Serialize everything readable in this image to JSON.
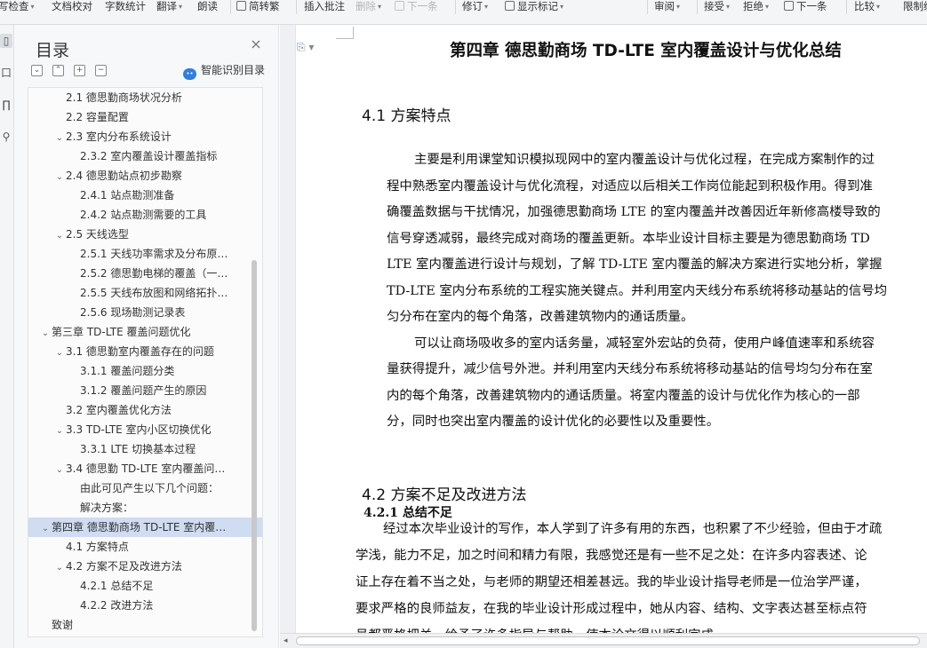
{
  "toolbar": {
    "items": [
      {
        "label": "写检查",
        "caret": true
      },
      {
        "label": "文档校对"
      },
      {
        "label": "字数统计"
      },
      {
        "label": "翻译",
        "caret": true
      },
      {
        "label": "朗读"
      },
      {
        "label": "简转繁",
        "icon": "convert-icon"
      },
      {
        "label": "插入批注"
      },
      {
        "label": "删除",
        "caret": true,
        "disabled": true
      },
      {
        "label": "下一条",
        "icon": "next-comment-icon",
        "disabled": true
      },
      {
        "label": "修订",
        "caret": true
      },
      {
        "label": "显示标记",
        "caret": true,
        "icon": "markup-icon"
      },
      {
        "label": "审阅",
        "caret": true
      },
      {
        "label": "接受",
        "caret": true
      },
      {
        "label": "拒绝",
        "caret": true
      },
      {
        "label": "下一条",
        "icon": "next-revision-icon"
      },
      {
        "label": "比较",
        "caret": true
      },
      {
        "label": "限制编"
      }
    ]
  },
  "sidebar_strip": {
    "icons": [
      "toc-icon",
      "bookmark-icon",
      "clipboard-icon",
      "search-icon"
    ],
    "glyphs": [
      "▯",
      "口",
      "∏",
      "⚲"
    ]
  },
  "toc": {
    "title": "目录",
    "close_glyph": "×",
    "controls": [
      "⌄",
      "⌃",
      "+",
      "−"
    ],
    "smart_label": "智能识别目录",
    "smart_icon_glyph": "••",
    "items": [
      {
        "level": 2,
        "text": "2.1 德思勤商场状况分析"
      },
      {
        "level": 2,
        "text": "2.2 容量配置"
      },
      {
        "level": 2,
        "text": "2.3 室内分布系统设计",
        "expanded": true
      },
      {
        "level": 3,
        "text": "2.3.2 室内覆盖设计覆盖指标"
      },
      {
        "level": 2,
        "text": "2.4 德思勤站点初步勘察",
        "expanded": true
      },
      {
        "level": 3,
        "text": "2.4.1 站点勘测准备"
      },
      {
        "level": 3,
        "text": "2.4.2 站点勘测需要的工具"
      },
      {
        "level": 2,
        "text": "2.5 天线选型",
        "expanded": true
      },
      {
        "level": 3,
        "text": "2.5.1 天线功率需求及分布原…"
      },
      {
        "level": 3,
        "text": "2.5.2 德思勤电梯的覆盖（一…"
      },
      {
        "level": 3,
        "text": "2.5.5 天线布放图和网络拓扑…"
      },
      {
        "level": 3,
        "text": "2.5.6 现场勘测记录表"
      },
      {
        "level": 1,
        "text": "第三章 TD-LTE 覆盖问题优化",
        "expanded": true
      },
      {
        "level": 2,
        "text": "3.1 德思勤室内覆盖存在的问题",
        "expanded": true
      },
      {
        "level": 3,
        "text": "3.1.1 覆盖问题分类"
      },
      {
        "level": 3,
        "text": "3.1.2 覆盖问题产生的原因"
      },
      {
        "level": 2,
        "text": "3.2 室内覆盖优化方法"
      },
      {
        "level": 2,
        "text": "3.3 TD-LTE 室内小区切换优化",
        "expanded": true
      },
      {
        "level": 3,
        "text": "3.3.1 LTE 切换基本过程"
      },
      {
        "level": 2,
        "text": "3.4 德思勤 TD-LTE 室内覆盖问…",
        "expanded": true
      },
      {
        "level": 3,
        "text": "由此可见产生以下几个问题："
      },
      {
        "level": 3,
        "text": "解决方案："
      },
      {
        "level": 1,
        "text": "第四章 德思勤商场 TD-LTE 室内覆…",
        "expanded": true,
        "selected": true
      },
      {
        "level": 2,
        "text": "4.1 方案特点"
      },
      {
        "level": 2,
        "text": "4.2 方案不足及改进方法",
        "expanded": true
      },
      {
        "level": 3,
        "text": "4.2.1 总结不足"
      },
      {
        "level": 3,
        "text": "4.2.2 改进方法"
      },
      {
        "level": 1,
        "text": "致谢"
      }
    ]
  },
  "document": {
    "page_mark": "⎘ ▾",
    "chapter_title": "第四章 德思勤商场 TD-LTE 室内覆盖设计与优化总结",
    "section_4_1": "4.1 方案特点",
    "lines_4_1": [
      "主要是利用课堂知识模拟现网中的室内覆盖设计与优化过程，在完成方案制作的过",
      "程中熟悉室内覆盖设计与优化流程，对适应以后相关工作岗位能起到积极作用。得到准",
      "确覆盖数据与干扰情况，加强德思勤商场 LTE 的室内覆盖并改善因近年新修高楼导致的",
      "信号穿透减弱，最终完成对商场的覆盖更新。本毕业设计目标主要是为德思勤商场 TD",
      "LTE 室内覆盖进行设计与规划，了解 TD-LTE 室内覆盖的解决方案进行实地分析，掌握",
      "TD-LTE 室内分布系统的工程实施关键点。并利用室内天线分布系统将移动基站的信号均",
      "匀分布在室内的每个角落，改善建筑物内的通话质量。",
      "可以让商场吸收多的室内话务量，减轻室外宏站的负荷，使用户峰值速率和系统容",
      "量获得提升，减少信号外泄。并利用室内天线分布系统将移动基站的信号均匀分布在室",
      "内的每个角落，改善建筑物内的通话质量。将室内覆盖的设计与优化作为核心的一部",
      "分，同时也突出室内覆盖的设计优化的必要性以及重要性。"
    ],
    "section_4_2": "4.2 方案不足及改进方法",
    "section_4_2_1": "4.2.1 总结不足",
    "lines_4_2_1": [
      "经过本次毕业设计的写作，本人学到了许多有用的东西，也积累了不少经验，但由于才疏",
      "学浅，能力不足，加之时间和精力有限，我感觉还是有一些不足之处：在许多内容表述、论",
      "证上存在着不当之处，与老师的期望还相差甚远。我的毕业设计指导老师是一位治学严谨，",
      "要求严格的良师益友，在我的毕业设计形成过程中，她从内容、结构、文字表达甚至标点符",
      "号都严格把关，给予了许多指导与帮助，使本论文得以顺利完成。"
    ]
  }
}
